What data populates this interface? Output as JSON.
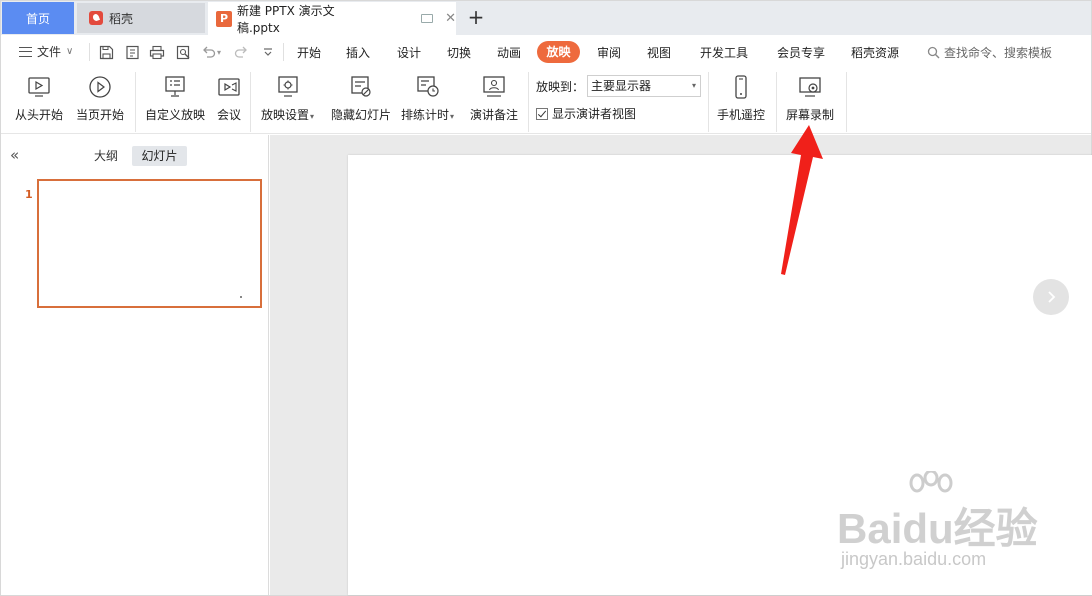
{
  "tabs": {
    "home": "首页",
    "daoke": "稻壳",
    "doc": "新建 PPTX 演示文稿.pptx",
    "add": "+"
  },
  "menu": {
    "file": "文件",
    "items": [
      "开始",
      "插入",
      "设计",
      "切换",
      "动画",
      "放映",
      "审阅",
      "视图",
      "开发工具",
      "会员专享",
      "稻壳资源"
    ],
    "active": "放映",
    "search": "查找命令、搜索模板"
  },
  "ribbon": {
    "from_start": "从头开始",
    "from_current": "当页开始",
    "custom_show": "自定义放映",
    "meeting": "会议",
    "show_settings": "放映设置",
    "hide_slide": "隐藏幻灯片",
    "rehearse": "排练计时",
    "speaker_notes": "演讲备注",
    "play_to_label": "放映到：",
    "play_to_value": "主要显示器",
    "presenter_view": "显示演讲者视图",
    "phone_remote": "手机遥控",
    "screen_record": "屏幕录制"
  },
  "panel": {
    "outline": "大纲",
    "slides": "幻灯片",
    "slide_number": "1"
  },
  "watermark": {
    "brand": "Baidu经验",
    "url": "jingyan.baidu.com"
  },
  "colors": {
    "accent": "#ee6a3d",
    "home_tab": "#5b8cf2",
    "arrow": "#f0201a"
  }
}
